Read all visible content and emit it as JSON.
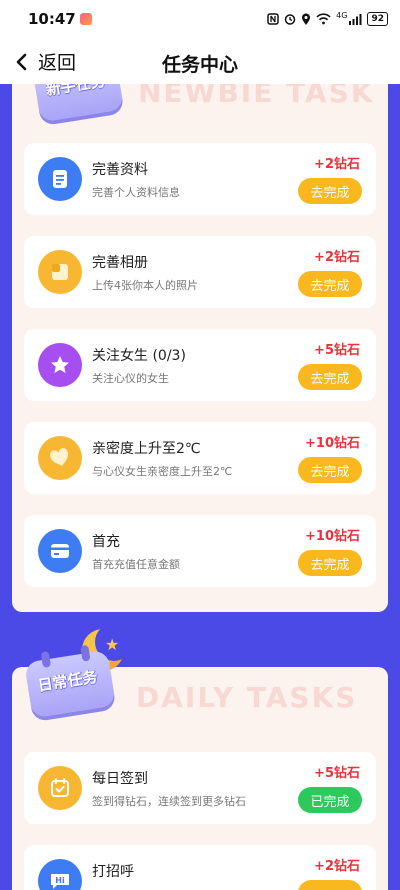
{
  "status_bar": {
    "time": "10:47",
    "network": "4G",
    "battery": "92"
  },
  "nav": {
    "back_label": "返回",
    "title": "任务中心"
  },
  "newbie": {
    "badge_label": "新手任务",
    "watermark": "NEWBIE TASK",
    "tasks": [
      {
        "title": "完善资料",
        "desc": "完善个人资料信息",
        "reward": "+2钻石",
        "button": "去完成",
        "icon": "document-icon",
        "color": "#3d7cf2"
      },
      {
        "title": "完善相册",
        "desc": "上传4张你本人的照片",
        "reward": "+2钻石",
        "button": "去完成",
        "icon": "photo-album-icon",
        "color": "#f7b733"
      },
      {
        "title": "关注女生 (0/3)",
        "desc": "关注心仪的女生",
        "reward": "+5钻石",
        "button": "去完成",
        "icon": "star-icon",
        "color": "#a64ef0"
      },
      {
        "title": "亲密度上升至2℃",
        "desc": "与心仪女生亲密度上升至2℃",
        "reward": "+10钻石",
        "button": "去完成",
        "icon": "heart-icon",
        "color": "#f7b733"
      },
      {
        "title": "首充",
        "desc": "首充充值任意金额",
        "reward": "+10钻石",
        "button": "去完成",
        "icon": "card-icon",
        "color": "#3d7cf2"
      }
    ]
  },
  "daily": {
    "badge_label": "日常任务",
    "watermark": "DAILY TASKS",
    "tasks": [
      {
        "title": "每日签到",
        "desc": "签到得钻石，连续签到更多钻石",
        "reward": "+5钻石",
        "button": "已完成",
        "icon": "calendar-check-icon",
        "color": "#f7b733"
      },
      {
        "title": "打招呼",
        "desc": "",
        "reward": "+2钻石",
        "button": "",
        "icon": "hi-icon",
        "color": "#3d7cf2"
      }
    ]
  },
  "colors": {
    "background": "#4b4ae6",
    "reward": "#e8323c",
    "button_todo": "#f9b81e",
    "button_done": "#2ec95c"
  }
}
